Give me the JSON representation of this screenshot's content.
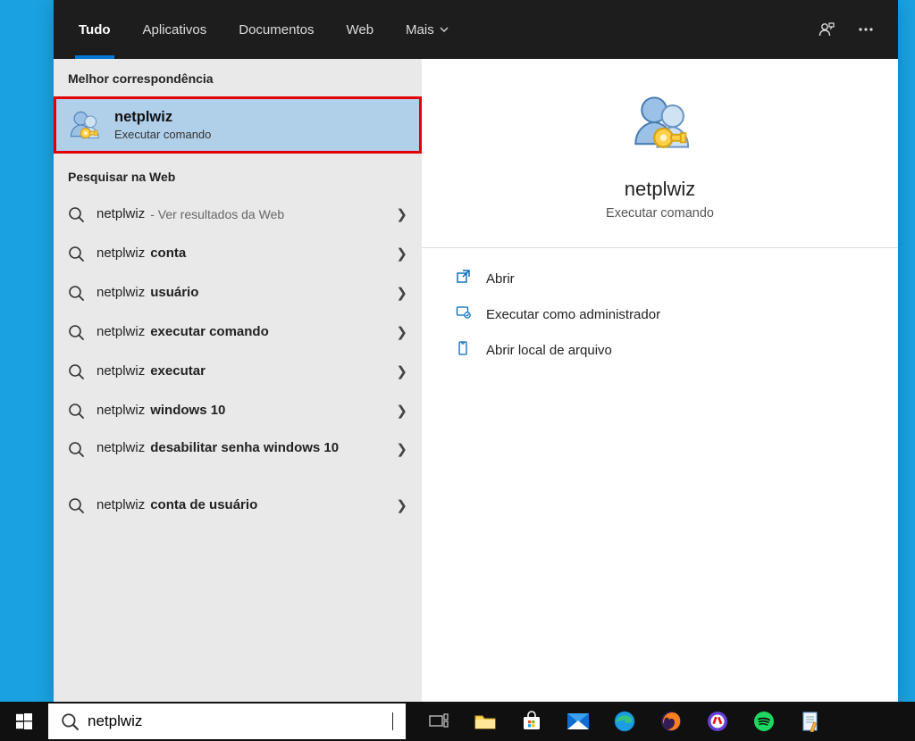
{
  "tabs": {
    "all": "Tudo",
    "apps": "Aplicativos",
    "documents": "Documentos",
    "web": "Web",
    "more": "Mais"
  },
  "sections": {
    "best_match": "Melhor correspondência",
    "search_web": "Pesquisar na Web"
  },
  "best_match": {
    "title": "netplwiz",
    "subtitle": "Executar comando"
  },
  "results": [
    {
      "primary": "netplwiz",
      "bold": "",
      "hint": "- Ver resultados da Web"
    },
    {
      "primary": "netplwiz ",
      "bold": "conta",
      "hint": ""
    },
    {
      "primary": "netplwiz ",
      "bold": "usuário",
      "hint": ""
    },
    {
      "primary": "netplwiz ",
      "bold": "executar comando",
      "hint": ""
    },
    {
      "primary": "netplwiz ",
      "bold": "executar",
      "hint": ""
    },
    {
      "primary": "netplwiz ",
      "bold": "windows 10",
      "hint": ""
    },
    {
      "primary": "netplwiz ",
      "bold": "desabilitar senha windows 10",
      "hint": ""
    },
    {
      "primary": "netplwiz ",
      "bold": "conta de usuário",
      "hint": ""
    }
  ],
  "preview": {
    "title": "netplwiz",
    "subtitle": "Executar comando",
    "actions": {
      "open": "Abrir",
      "run_admin": "Executar como administrador",
      "open_location": "Abrir local de arquivo"
    }
  },
  "search_input": {
    "value": "netplwiz"
  }
}
